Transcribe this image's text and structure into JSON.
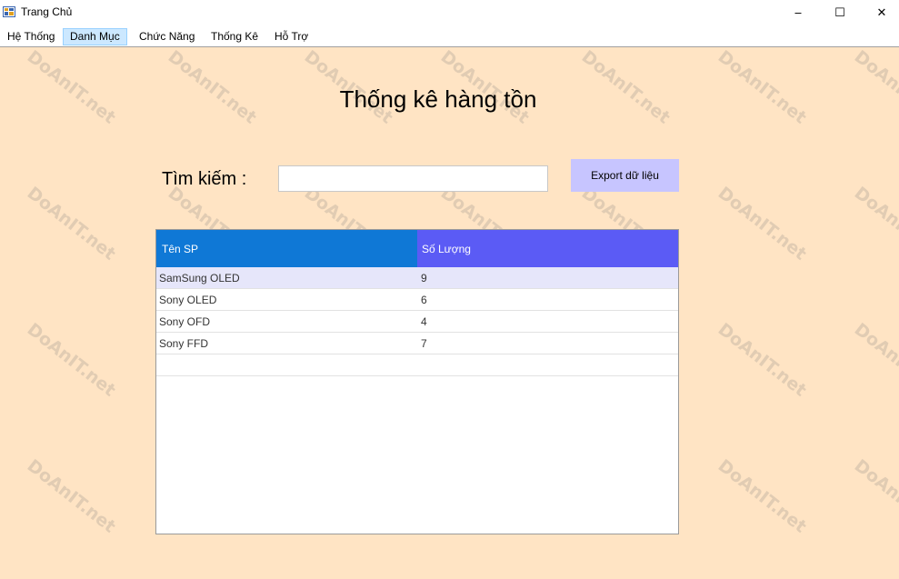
{
  "window": {
    "title": "Trang Chủ",
    "controls": {
      "minimize": "‒",
      "maximize": "☐",
      "close": "✕"
    }
  },
  "menu": {
    "items": [
      {
        "label": "Hệ Thống",
        "active": false
      },
      {
        "label": "Danh Mục",
        "active": true
      },
      {
        "label": "Chức Năng",
        "active": false
      },
      {
        "label": "Thống Kê",
        "active": false
      },
      {
        "label": "Hỗ Trợ",
        "active": false
      }
    ]
  },
  "main": {
    "title": "Thống kê hàng tồn",
    "search_label": "Tìm kiếm :",
    "search_value": "",
    "export_label": "Export dữ liệu"
  },
  "table": {
    "headers": [
      "Tên SP",
      "Số Lượng"
    ],
    "rows": [
      [
        "SamSung OLED",
        "9"
      ],
      [
        "Sony OLED",
        "6"
      ],
      [
        "Sony OFD",
        "4"
      ],
      [
        "Sony FFD",
        "7"
      ]
    ],
    "selected_row": 0
  },
  "watermark": {
    "text": "DoAnIT.net"
  },
  "colors": {
    "background": "#ffe4c4",
    "header_name": "#0f78d6",
    "header_qty": "#5b5bf5",
    "export_button": "#c7c5ff",
    "selected_row": "#e6e6fa",
    "menu_active": "#cce8ff"
  }
}
